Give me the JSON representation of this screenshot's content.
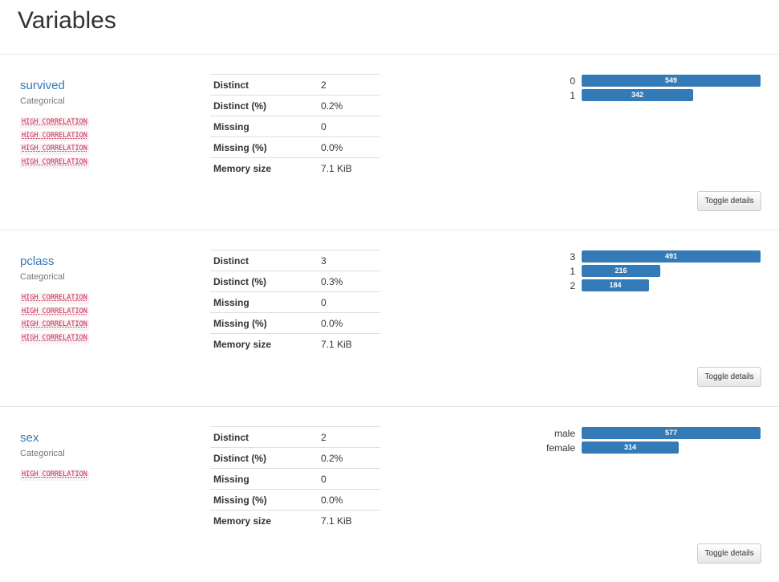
{
  "page": {
    "title": "Variables"
  },
  "colors": {
    "link": "#337ab7",
    "bar": "#337ab7",
    "badge_bg": "#f9f2f4",
    "badge_text": "#c7254e"
  },
  "variables": [
    {
      "name": "survived",
      "type": "Categorical",
      "badges": [
        "HIGH CORRELATION",
        "HIGH CORRELATION",
        "HIGH CORRELATION",
        "HIGH CORRELATION"
      ],
      "stats": [
        {
          "label": "Distinct",
          "value": "2"
        },
        {
          "label": "Distinct (%)",
          "value": "0.2%"
        },
        {
          "label": "Missing",
          "value": "0"
        },
        {
          "label": "Missing (%)",
          "value": "0.0%"
        },
        {
          "label": "Memory size",
          "value": "7.1 KiB"
        }
      ],
      "frequencies": [
        {
          "label": "0",
          "count": 549,
          "count_text": "549"
        },
        {
          "label": "1",
          "count": 342,
          "count_text": "342"
        }
      ],
      "toggle_label": "Toggle details"
    },
    {
      "name": "pclass",
      "type": "Categorical",
      "badges": [
        "HIGH CORRELATION",
        "HIGH CORRELATION",
        "HIGH CORRELATION",
        "HIGH CORRELATION"
      ],
      "stats": [
        {
          "label": "Distinct",
          "value": "3"
        },
        {
          "label": "Distinct (%)",
          "value": "0.3%"
        },
        {
          "label": "Missing",
          "value": "0"
        },
        {
          "label": "Missing (%)",
          "value": "0.0%"
        },
        {
          "label": "Memory size",
          "value": "7.1 KiB"
        }
      ],
      "frequencies": [
        {
          "label": "3",
          "count": 491,
          "count_text": "491"
        },
        {
          "label": "1",
          "count": 216,
          "count_text": "216"
        },
        {
          "label": "2",
          "count": 184,
          "count_text": "184"
        }
      ],
      "toggle_label": "Toggle details"
    },
    {
      "name": "sex",
      "type": "Categorical",
      "badges": [
        "HIGH CORRELATION"
      ],
      "stats": [
        {
          "label": "Distinct",
          "value": "2"
        },
        {
          "label": "Distinct (%)",
          "value": "0.2%"
        },
        {
          "label": "Missing",
          "value": "0"
        },
        {
          "label": "Missing (%)",
          "value": "0.0%"
        },
        {
          "label": "Memory size",
          "value": "7.1 KiB"
        }
      ],
      "frequencies": [
        {
          "label": "male",
          "count": 577,
          "count_text": "577"
        },
        {
          "label": "female",
          "count": 314,
          "count_text": "314"
        }
      ],
      "toggle_label": "Toggle details"
    }
  ]
}
